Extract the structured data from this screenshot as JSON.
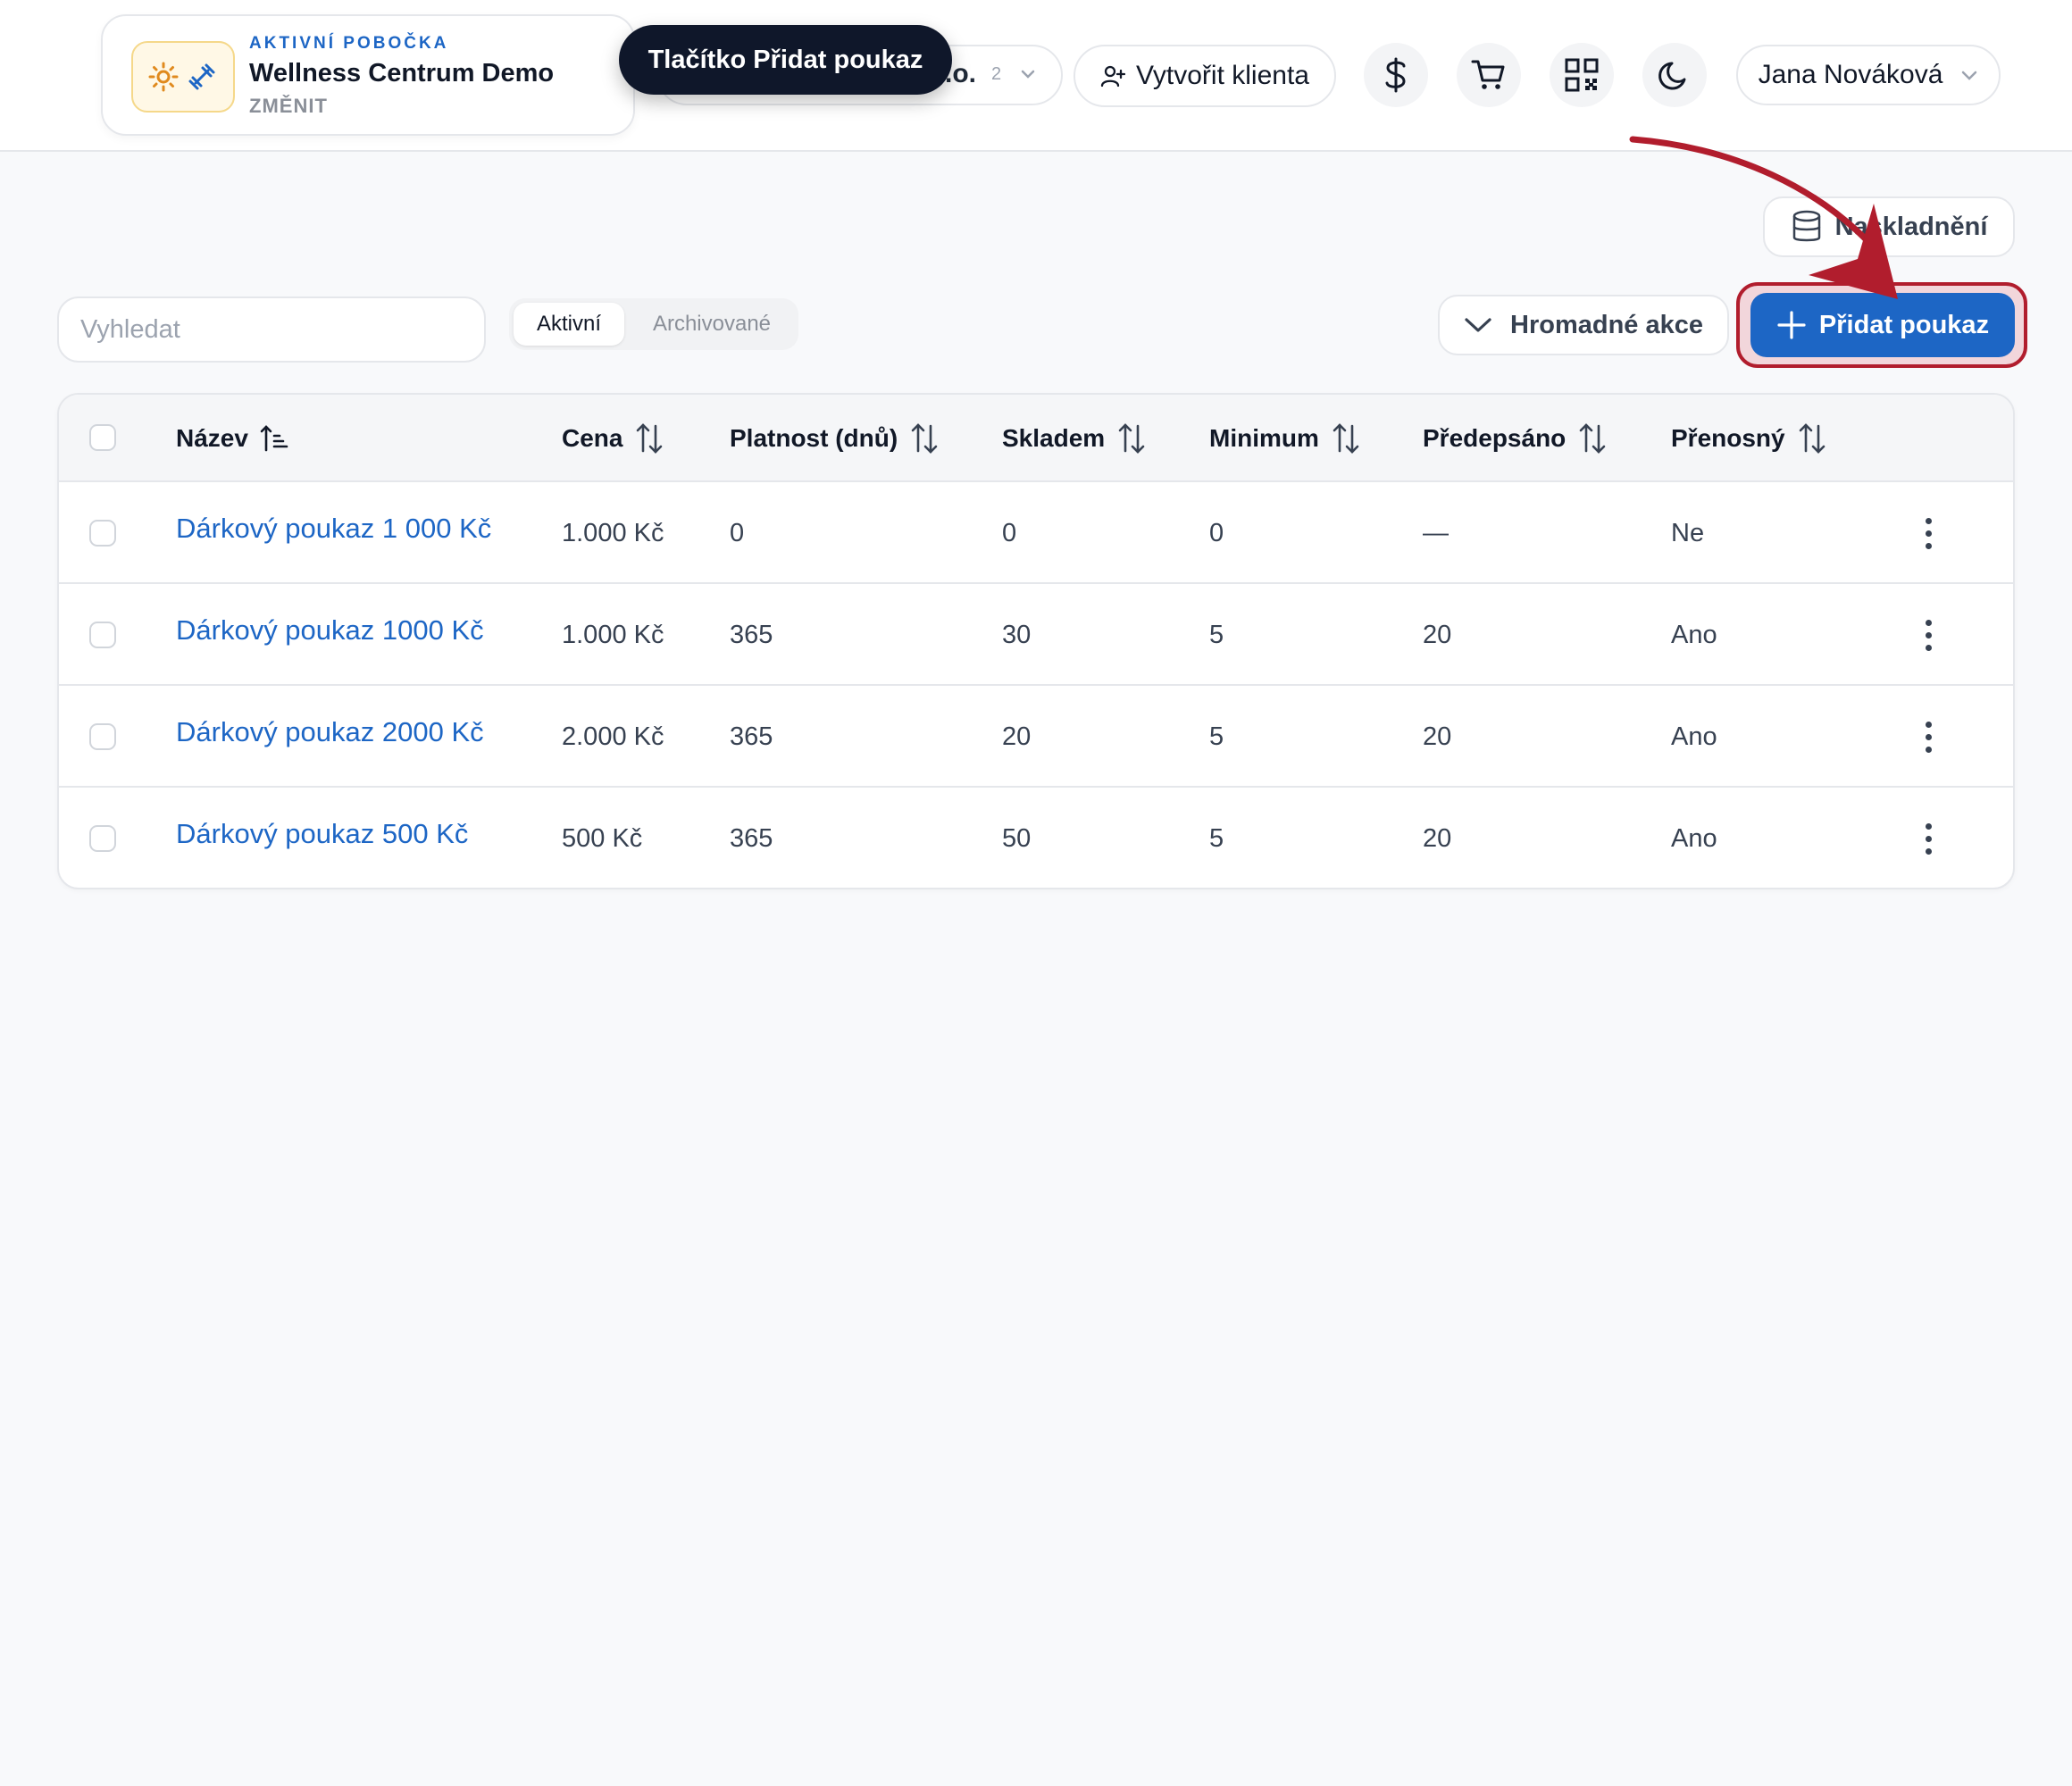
{
  "branch": {
    "kicker": "AKTIVNÍ POBOČKA",
    "name": "Wellness Centrum Demo",
    "change_label": "ZMĚNIT"
  },
  "company_select": {
    "value": ".o.",
    "count": "2"
  },
  "tooltip": {
    "text": "Tlačítko Přidat poukaz"
  },
  "header": {
    "create_client_label": "Vytvořit klienta",
    "user_name": "Jana Nováková",
    "icons": [
      "dollar-icon",
      "cart-icon",
      "qr-code-icon",
      "moon-icon"
    ]
  },
  "toolbar": {
    "stock_label": "Naskladnění",
    "search_placeholder": "Vyhledat",
    "tabs": {
      "active": "Aktivní",
      "archived": "Archivované"
    },
    "bulk_actions_label": "Hromadné akce",
    "add_label": "Přidat poukaz"
  },
  "table": {
    "columns": [
      "Název",
      "Cena",
      "Platnost (dnů)",
      "Skladem",
      "Minimum",
      "Předepsáno",
      "Přenosný"
    ],
    "rows": [
      {
        "name": "Dárkový poukaz 1 000 Kč",
        "price": "1.000 Kč",
        "validity": "0",
        "stock": "0",
        "minimum": "0",
        "prescribed": "—",
        "transferable": "Ne"
      },
      {
        "name": "Dárkový poukaz 1000 Kč",
        "price": "1.000 Kč",
        "validity": "365",
        "stock": "30",
        "minimum": "5",
        "prescribed": "20",
        "transferable": "Ano"
      },
      {
        "name": "Dárkový poukaz 2000 Kč",
        "price": "2.000 Kč",
        "validity": "365",
        "stock": "20",
        "minimum": "5",
        "prescribed": "20",
        "transferable": "Ano"
      },
      {
        "name": "Dárkový poukaz 500 Kč",
        "price": "500 Kč",
        "validity": "365",
        "stock": "50",
        "minimum": "5",
        "prescribed": "20",
        "transferable": "Ano"
      }
    ]
  },
  "colors": {
    "accent": "#1d66c5",
    "highlight": "#b11d2d",
    "tooltip_bg": "#0f172a"
  }
}
